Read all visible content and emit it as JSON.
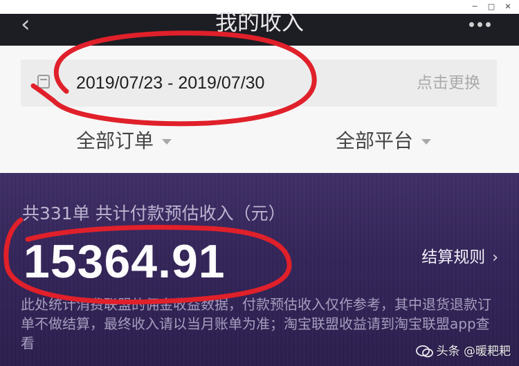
{
  "header": {
    "title": "我的收入",
    "back_icon": "chevron-left-icon",
    "more_icon": "more-dots-icon"
  },
  "window": {
    "minimize": "─",
    "maximize": "□",
    "close": "✕"
  },
  "date_filter": {
    "range": "2019/07/23 - 2019/07/30",
    "change_label": "点击更换",
    "icon": "calendar-icon"
  },
  "filters": {
    "orders": "全部订单",
    "platform": "全部平台"
  },
  "summary": {
    "label": "共331单 共计付款预估收入（元）",
    "amount": "15364.91",
    "rules_label": "结算规则",
    "disclaimer": "此处统计消费联盟的佣金收益数据，付款预估收入仅作参考，其中退货退款订单不做结算，最终收入请以当月账单为准；淘宝联盟收益请到淘宝联盟app查看"
  },
  "watermark": {
    "text": "头条 @暖耙耙"
  },
  "colors": {
    "annotation_red": "#e0202a",
    "summary_bg": "#35265a"
  }
}
